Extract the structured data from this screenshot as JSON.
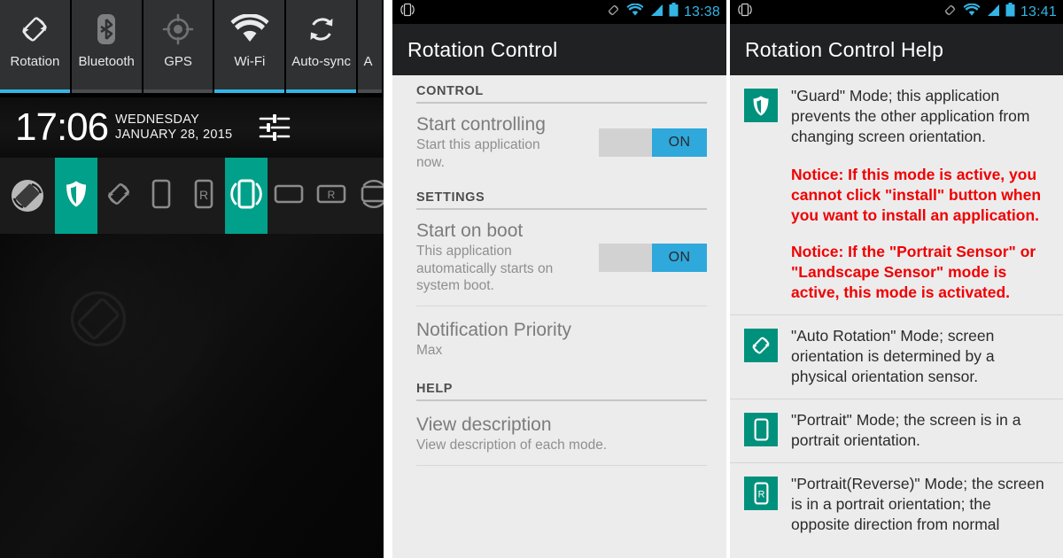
{
  "panel_notification": {
    "quick_settings": [
      {
        "label": "Rotation",
        "icon": "auto-rotate-icon",
        "state": "on"
      },
      {
        "label": "Bluetooth",
        "icon": "bluetooth-icon",
        "state": "off"
      },
      {
        "label": "GPS",
        "icon": "gps-icon",
        "state": "off"
      },
      {
        "label": "Wi-Fi",
        "icon": "wifi-icon",
        "state": "on"
      },
      {
        "label": "Auto-sync",
        "icon": "autosync-icon",
        "state": "on"
      },
      {
        "label": "A",
        "icon": "clipped-tile-icon",
        "state": "off"
      }
    ],
    "clock": {
      "time": "17:06",
      "weekday": "WEDNESDAY",
      "date": "JANUARY 28, 2015",
      "settings_icon": "sliders-icon"
    },
    "mode_bar": {
      "app_icon": "rotation-control-app-icon",
      "modes": [
        {
          "name": "guard",
          "icon": "shield-icon",
          "selected": true
        },
        {
          "name": "auto-rotation",
          "icon": "auto-rotate-icon",
          "selected": false
        },
        {
          "name": "portrait",
          "icon": "portrait-icon",
          "selected": false
        },
        {
          "name": "portrait-reverse",
          "icon": "portrait-reverse-icon",
          "selected": false
        },
        {
          "name": "portrait-sensor",
          "icon": "portrait-sensor-icon",
          "selected": true
        },
        {
          "name": "landscape",
          "icon": "landscape-icon",
          "selected": false
        },
        {
          "name": "landscape-reverse",
          "icon": "landscape-reverse-icon",
          "selected": false
        },
        {
          "name": "landscape-sensor",
          "icon": "landscape-sensor-icon",
          "selected": false
        }
      ]
    }
  },
  "panel_settings": {
    "status_bar": {
      "time": "13:38",
      "left_icon": "portrait-sensor-notification-icon",
      "icons": [
        "rotation-icon",
        "wifi-icon",
        "signal-icon",
        "battery-icon"
      ]
    },
    "action_bar": {
      "title": "Rotation Control"
    },
    "sections": [
      {
        "header": "CONTROL",
        "items": [
          {
            "title": "Start controlling",
            "summary": "Start this application now.",
            "toggle": "ON"
          }
        ]
      },
      {
        "header": "SETTINGS",
        "items": [
          {
            "title": "Start on boot",
            "summary": "This application automatically starts on system boot.",
            "toggle": "ON"
          },
          {
            "title": "Notification Priority",
            "summary": "Max"
          }
        ]
      },
      {
        "header": "HELP",
        "items": [
          {
            "title": "View description",
            "summary": "View description of each mode."
          }
        ]
      }
    ]
  },
  "panel_help": {
    "status_bar": {
      "time": "13:41",
      "left_icon": "portrait-sensor-notification-icon",
      "icons": [
        "rotation-icon",
        "wifi-icon",
        "signal-icon",
        "battery-icon"
      ]
    },
    "action_bar": {
      "title": "Rotation Control Help"
    },
    "accent_color": "#00917d",
    "notice_color": "#f00000",
    "rows": [
      {
        "icon": "shield-icon",
        "text": "\"Guard\" Mode; this application prevents the other application from changing screen orientation.",
        "notices": [
          "Notice: If this mode is active, you cannot click \"install\" button when you want to install an application.",
          "Notice: If the \"Portrait Sensor\" or \"Landscape Sensor\" mode is active, this mode is activated."
        ]
      },
      {
        "icon": "auto-rotate-icon",
        "text": "\"Auto Rotation\" Mode; screen orientation is determined by a physical orientation sensor.",
        "notices": []
      },
      {
        "icon": "portrait-icon",
        "text": "\"Portrait\" Mode; the screen is in a portrait orientation.",
        "notices": []
      },
      {
        "icon": "portrait-reverse-icon",
        "text": "\"Portrait(Reverse)\" Mode; the screen is in a portrait orientation; the opposite direction from normal",
        "notices": []
      }
    ]
  }
}
